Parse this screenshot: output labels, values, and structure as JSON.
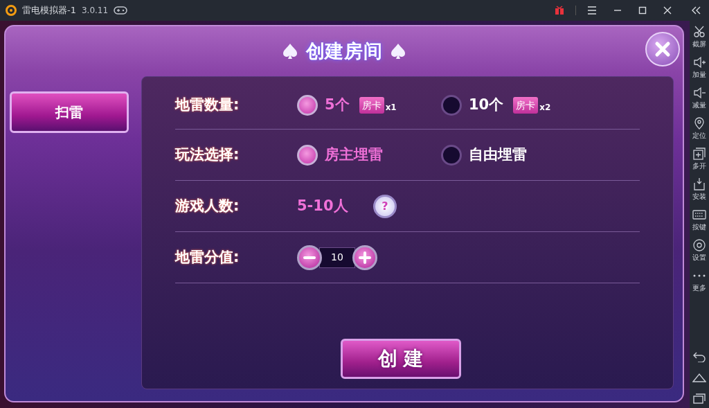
{
  "window": {
    "title": "雷电模拟器-1",
    "version": "3.0.11"
  },
  "side_tools": [
    {
      "label": "截屏"
    },
    {
      "label": "加量"
    },
    {
      "label": "减量"
    },
    {
      "label": "定位"
    },
    {
      "label": "多开"
    },
    {
      "label": "安装"
    },
    {
      "label": "按键"
    },
    {
      "label": "设置"
    },
    {
      "label": "更多"
    }
  ],
  "dialog": {
    "title": "创建房间",
    "tabs": [
      {
        "label": "扫雷",
        "selected": true
      }
    ],
    "rows": [
      {
        "kind": "radio",
        "label": "地雷数量:",
        "options": [
          {
            "text": "5个",
            "badge": "房卡",
            "multiplier": "x1",
            "selected": true
          },
          {
            "text": "10个",
            "badge": "房卡",
            "multiplier": "x2",
            "selected": false
          }
        ]
      },
      {
        "kind": "radio",
        "label": "玩法选择:",
        "options": [
          {
            "text": "房主埋雷",
            "selected": true
          },
          {
            "text": "自由埋雷",
            "selected": false
          }
        ]
      },
      {
        "kind": "info",
        "label": "游戏人数:",
        "value": "5-10人",
        "help": "?"
      },
      {
        "kind": "stepper",
        "label": "地雷分值:",
        "value": "10"
      }
    ],
    "create_button": "创 建"
  }
}
